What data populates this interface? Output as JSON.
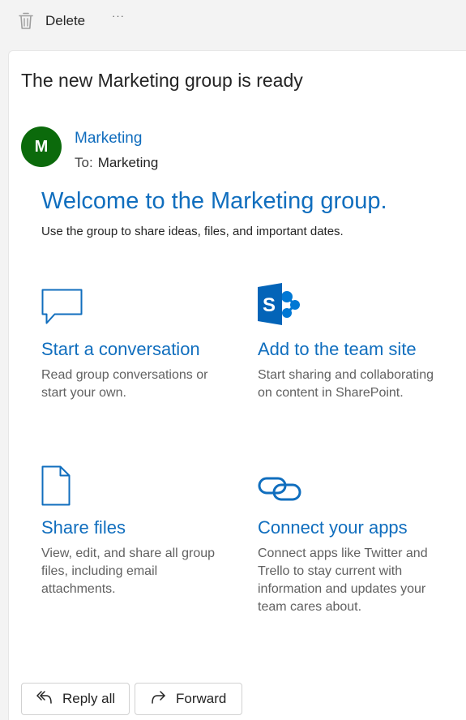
{
  "toolbar": {
    "delete_label": "Delete",
    "more_label": "···"
  },
  "message": {
    "subject": "The new Marketing group is ready",
    "avatar_initial": "M",
    "avatar_color": "#0b6a0b",
    "sender": "Marketing",
    "to_label": "To:",
    "to_value": "Marketing"
  },
  "body": {
    "welcome": "Welcome to the Marketing group.",
    "intro": "Use the group to share ideas, files, and important dates.",
    "features": [
      {
        "icon": "chat-bubble-icon",
        "title": "Start a conversation",
        "desc": "Read group conversations or start your own."
      },
      {
        "icon": "sharepoint-icon",
        "title": "Add to the team site",
        "desc": "Start sharing and collaborating on content in SharePoint."
      },
      {
        "icon": "document-icon",
        "title": "Share files",
        "desc": "View, edit, and share all group files, including email attachments."
      },
      {
        "icon": "link-icon",
        "title": "Connect your apps",
        "desc": "Connect apps like Twitter and Trello to stay current with information and updates your team cares about."
      }
    ]
  },
  "actions": {
    "reply_all": "Reply all",
    "forward": "Forward"
  },
  "colors": {
    "accent": "#106ebe",
    "link": "#0f6cbd",
    "sharepoint": "#0078d4"
  }
}
